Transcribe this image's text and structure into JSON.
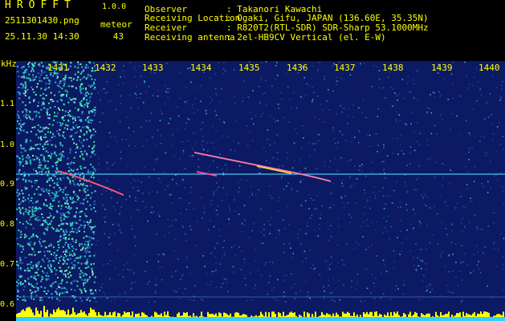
{
  "app": {
    "title": "HROFFT",
    "version": "1.0.0"
  },
  "file": {
    "name": "2511301430.png",
    "datetime": "25.11.30 14:30"
  },
  "meteor": {
    "label": "meteor",
    "count": "43"
  },
  "info": [
    {
      "label": "Observer",
      "value": ": Takanori Kawachi"
    },
    {
      "label": "Receiving Location",
      "value": ": Ogaki, Gifu, JAPAN (136.60E, 35.35N)"
    },
    {
      "label": "Receiver",
      "value": ": R820T2(RTL-SDR) SDR-Sharp 53.1000MHz"
    },
    {
      "label": "Receiving antenna",
      "value": ": 2el-HB9CV Vertical (el. E-W)"
    }
  ],
  "axes": {
    "y_unit": "kHz",
    "x_ticks": [
      "1431",
      "1432",
      "1433",
      "1434",
      "1435",
      "1436",
      "1437",
      "1438",
      "1439",
      "1440"
    ],
    "y_ticks": [
      "1.1",
      "1.0",
      "0.9",
      "0.8",
      "0.7",
      "0.6"
    ]
  },
  "colors": {
    "background": "#0c1a63",
    "label_text": "#ffff00",
    "header_values": "#00ff00",
    "carrier_line": "#4fd8ff",
    "baseline_noise": "#ffff00"
  }
}
